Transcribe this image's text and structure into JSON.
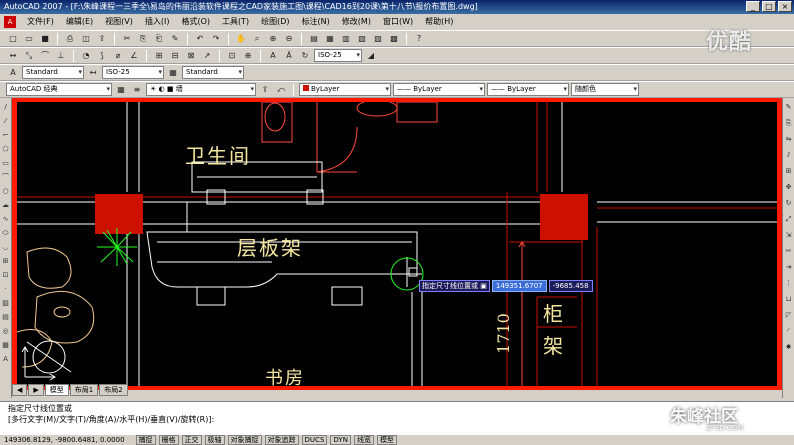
{
  "window": {
    "title": "AutoCAD 2007 - [F:\\朱峰课程一三季全\\易岛的伟丽沿装软件课程之CAD家装施工图\\课程\\CAD16到20课\\第十八节\\报价布置图.dwg]",
    "min_label": "_",
    "max_label": "□",
    "close_label": "×"
  },
  "menu": {
    "items": [
      "文件(F)",
      "编辑(E)",
      "视图(V)",
      "插入(I)",
      "格式(O)",
      "工具(T)",
      "绘图(D)",
      "标注(N)",
      "修改(M)",
      "窗口(W)",
      "帮助(H)"
    ]
  },
  "styles_toolbar": {
    "text_style": "Standard",
    "dim_style": "ISO-25",
    "table_style": "Standard",
    "dim_style_top": "ISO-25"
  },
  "layers_toolbar": {
    "workspace": "AutoCAD 经典",
    "layer": "墙",
    "color": "ByLayer",
    "linetype": "ByLayer",
    "lineweight": "ByLayer",
    "plotstyle": "随颜色"
  },
  "drawing": {
    "labels": {
      "bathroom": "卫生间",
      "shelf": "层板架",
      "study": "书房",
      "cabinet_1": "柜",
      "cabinet_2": "架",
      "dimension": "1710"
    }
  },
  "dynamic_input": {
    "prompt": "指定尺寸线位置或",
    "x_value": "149351.6707",
    "y_value": "-9685.458"
  },
  "tabs": [
    "模型",
    "布局1",
    "布局2"
  ],
  "command": {
    "line1": "指定尺寸线位置或",
    "line2": "[多行文字(M)/文字(T)/角度(A)/水平(H)/垂直(V)/旋转(R)]:"
  },
  "status": {
    "coords": "149306.8129, -9800.6481, 0.0000",
    "buttons": [
      "捕捉",
      "栅格",
      "正交",
      "极轴",
      "对象捕捉",
      "对象追踪",
      "DUCS",
      "DYN",
      "线宽",
      "模型"
    ]
  },
  "watermarks": {
    "top": "优酷",
    "bottom": "朱峰社区",
    "bottom_sub": "ZF3D.COM"
  },
  "colors": {
    "frame": "#ff1a00",
    "canvas": "#000000",
    "wall_red": "#cc1100",
    "text_yellow": "#f5e7a0",
    "line_white": "#ffffff",
    "plant_green": "#22ff22"
  }
}
